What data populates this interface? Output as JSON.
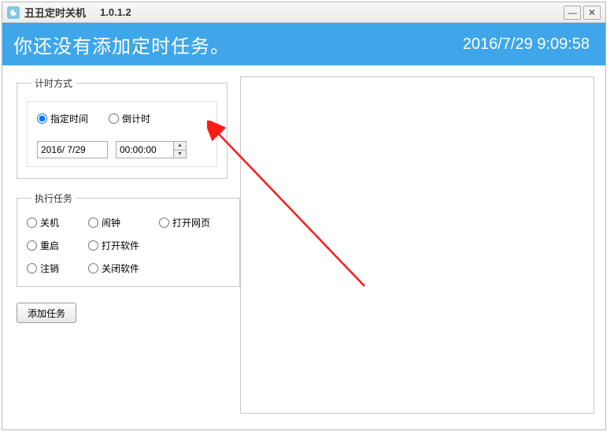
{
  "titlebar": {
    "title": "丑丑定时关机",
    "version": "1.0.1.2"
  },
  "banner": {
    "message": "你还没有添加定时任务。",
    "datetime": "2016/7/29 9:09:58"
  },
  "timing": {
    "legend": "计时方式",
    "modes": {
      "specified": "指定时间",
      "countdown": "倒计时"
    },
    "date_value": "2016/ 7/29",
    "time_value": "00:00:00"
  },
  "tasks": {
    "legend": "执行任务",
    "options": {
      "shutdown": "关机",
      "alarm": "闹钟",
      "open_webpage": "打开网页",
      "restart": "重启",
      "open_software": "打开软件",
      "logout": "注销",
      "close_software": "关闭软件"
    }
  },
  "buttons": {
    "add_task": "添加任务"
  }
}
